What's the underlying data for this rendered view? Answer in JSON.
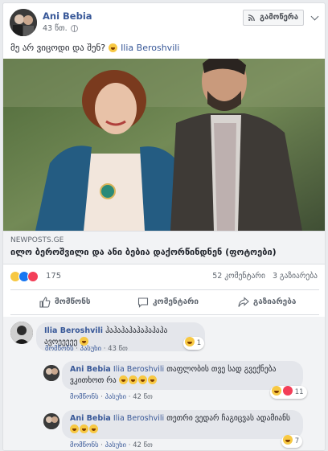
{
  "post": {
    "author": "Ani Bebia",
    "time": "43 წთ.",
    "follow_label": "გამოწერა",
    "text": "მე არ ვიცოდი და შენ?",
    "tagged": "Ilia Beroshvili"
  },
  "link": {
    "domain": "NEWPOSTS.GE",
    "title": "ილო ბეროშვილი და ანი ბებია დაქორწინდნენ (ფოტოები)"
  },
  "reactions": {
    "count": "175",
    "comments": "52 კომენტარი",
    "shares": "3 გაზიარება"
  },
  "actions": {
    "like": "მომწონს",
    "comment": "კომენტარი",
    "share": "გაზიარება"
  },
  "comments": [
    {
      "author": "Ilia Beroshvili",
      "text": "ჰაჰაჰაჰაჰაჰაჰაჰა ავოეეეეე",
      "like": "მომწონს",
      "reply": "პასუხი",
      "time": "43 წთ",
      "reaction_count": "1"
    },
    {
      "author": "Ani Bebia",
      "tag": "Ilia Beroshvili",
      "text": "თაფლობის თვე სად გვექნება ვკითხოთ რა",
      "like": "მომწონს",
      "reply": "პასუხი",
      "time": "42 წთ",
      "reaction_count": "11"
    },
    {
      "author": "Ani Bebia",
      "tag": "Ilia Beroshvili",
      "text": "თეთრი ვედარ ჩაგიცვას ადამიანს",
      "like": "მომწონს",
      "reply": "პასუხი",
      "time": "42 წთ",
      "reaction_count": "7"
    }
  ],
  "colors": {
    "link_blue": "#385898",
    "like_blue": "#1877f2",
    "love_red": "#f33e58",
    "haha_yellow": "#f7c843"
  }
}
